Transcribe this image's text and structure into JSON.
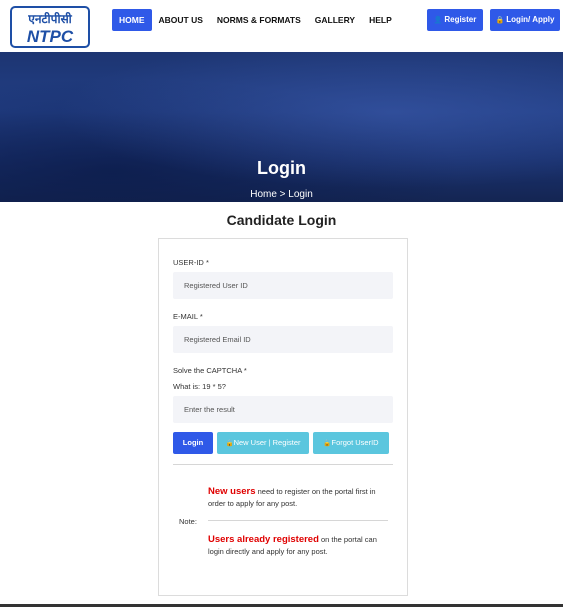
{
  "logo": {
    "hindi_text": "एनटीपीसी",
    "latin_text": "NTPC",
    "brand_color": "#1e4fa6"
  },
  "nav": {
    "items": [
      {
        "label": "HOME",
        "active": true
      },
      {
        "label": "ABOUT US",
        "active": false
      },
      {
        "label": "NORMS & FORMATS",
        "active": false
      },
      {
        "label": "GALLERY",
        "active": false
      },
      {
        "label": "HELP",
        "active": false
      }
    ],
    "register_label": "Register",
    "register_icon": "user-icon",
    "login_apply_label": "Login/ Apply",
    "login_apply_icon": "lock-icon",
    "accent_color": "#2f59e8"
  },
  "banner": {
    "title": "Login",
    "breadcrumb": "Home > Login"
  },
  "page": {
    "heading": "Candidate Login"
  },
  "form": {
    "user_id": {
      "label": "USER-ID",
      "required_mark": "*",
      "placeholder": "Registered User ID",
      "value": ""
    },
    "email": {
      "label": "E-MAIL",
      "required_mark": "*",
      "placeholder": "Registered Email ID",
      "value": ""
    },
    "captcha": {
      "label": "Solve the CAPTCHA",
      "required_mark": "*",
      "question": "What is: 19 * 5?",
      "placeholder": "Enter the result",
      "value": ""
    },
    "login_label": "Login",
    "new_user_label": "New User | Register",
    "new_user_icon": "lock-icon",
    "forgot_label": "Forgot UserID",
    "forgot_icon": "lock-icon",
    "secondary_color": "#5bc6de"
  },
  "note": {
    "label": "Note:",
    "new_users_bold": "New users",
    "new_users_text": " need to register on the portal first in order to apply for any post.",
    "registered_bold": "Users already registered",
    "registered_text": " on the portal can login directly and apply for any post.",
    "highlight_color": "#e00000"
  }
}
